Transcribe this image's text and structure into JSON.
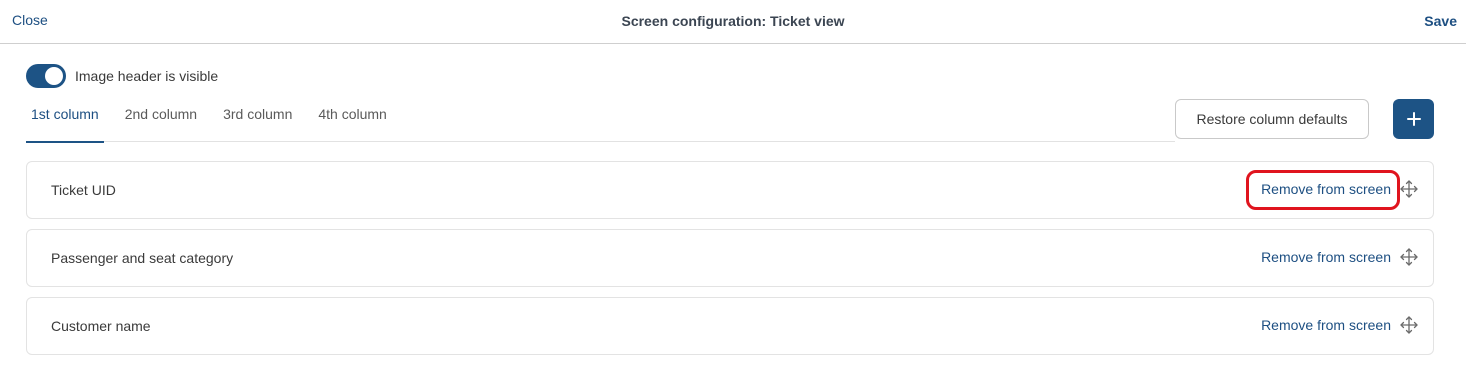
{
  "header": {
    "close_label": "Close",
    "title": "Screen configuration: Ticket view",
    "save_label": "Save"
  },
  "toggle": {
    "label": "Image header is visible",
    "state": "on"
  },
  "tabs": [
    {
      "label": "1st column",
      "active": true
    },
    {
      "label": "2nd column",
      "active": false
    },
    {
      "label": "3rd column",
      "active": false
    },
    {
      "label": "4th column",
      "active": false
    }
  ],
  "toolbar": {
    "restore_label": "Restore column defaults",
    "add_icon": "plus-icon"
  },
  "rows": [
    {
      "label": "Ticket UID",
      "action": "Remove from screen",
      "highlighted": true
    },
    {
      "label": "Passenger and seat category",
      "action": "Remove from screen",
      "highlighted": false
    },
    {
      "label": "Customer name",
      "action": "Remove from screen",
      "highlighted": false
    }
  ],
  "colors": {
    "accent": "#1d5385",
    "link": "#1d4f82",
    "highlight": "#e0141e"
  }
}
